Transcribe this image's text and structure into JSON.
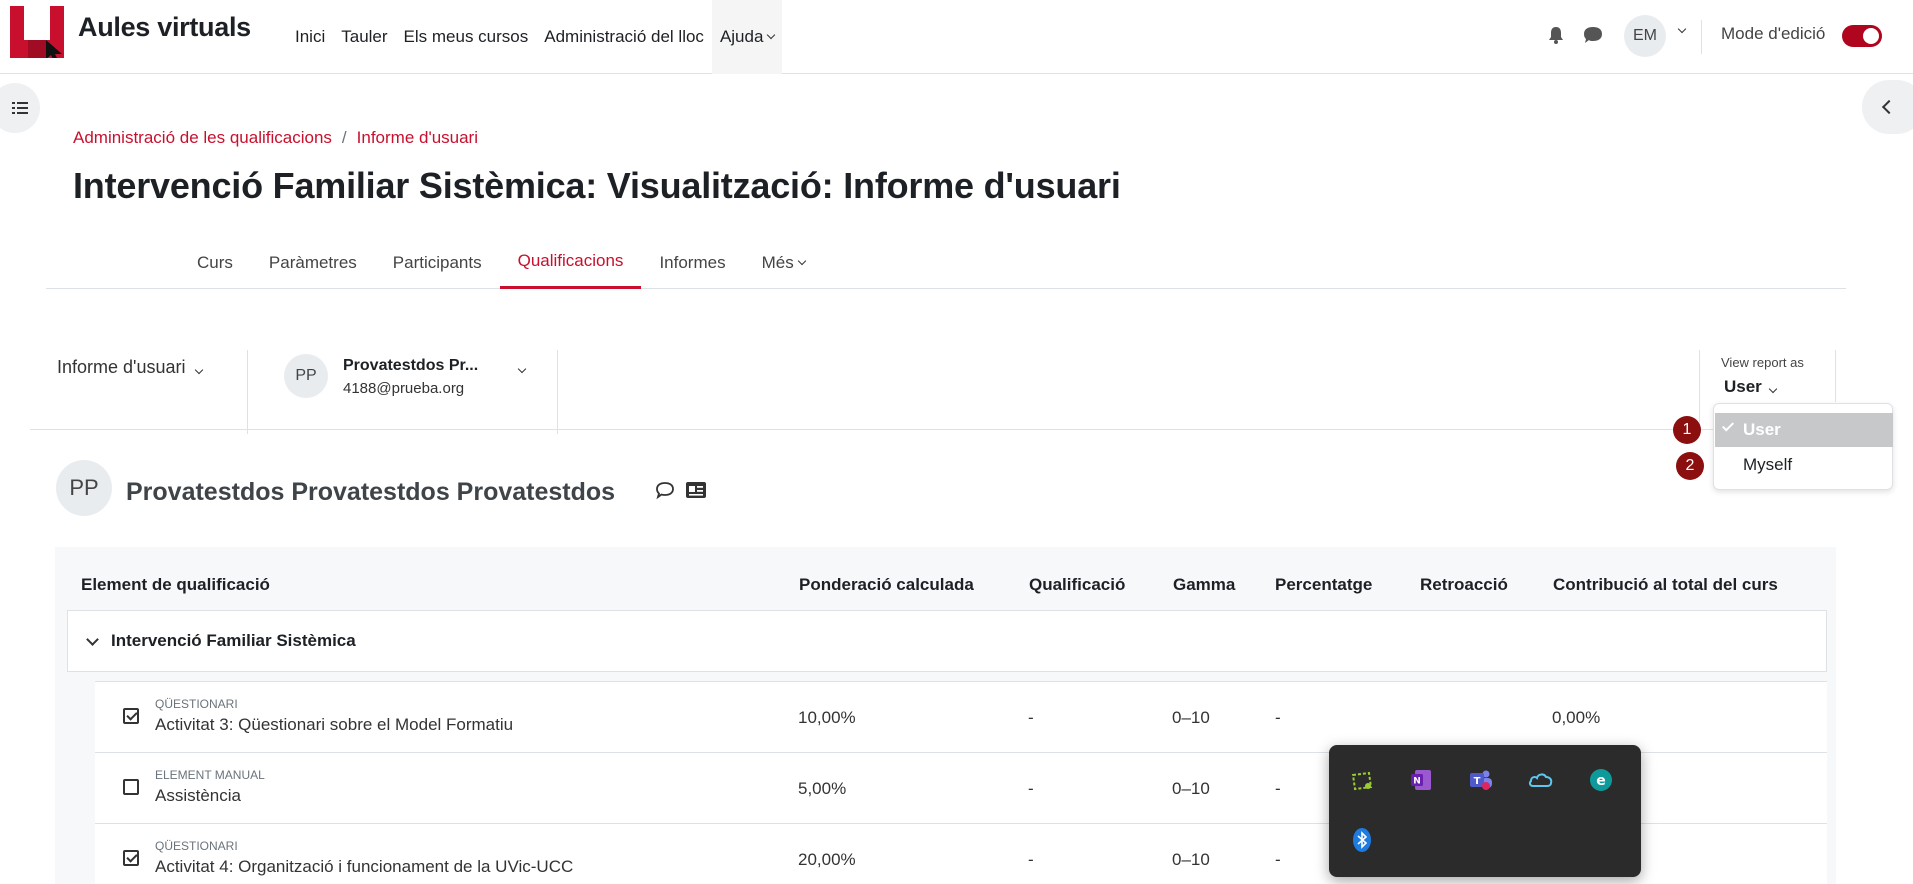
{
  "navbar": {
    "site_name": "Aules virtuals",
    "nav_items": [
      "Inici",
      "Tauler",
      "Els meus cursos",
      "Administració del lloc",
      "Ajuda"
    ],
    "user_initials": "EM",
    "edit_mode_label": "Mode d'edició",
    "edit_mode_on": true
  },
  "breadcrumb": {
    "items": [
      "Administració de les qualificacions",
      "Informe d'usuari"
    ],
    "separator": "/"
  },
  "page_title": "Intervenció Familiar Sistèmica: Visualització: Informe d'usuari",
  "secondary_nav": {
    "tabs": [
      "Curs",
      "Paràmetres",
      "Participants",
      "Qualificacions",
      "Informes",
      "Més"
    ],
    "active": "Qualificacions"
  },
  "tertiary": {
    "report_select": "Informe d'usuari",
    "user_initials": "PP",
    "user_name": "Provatestdos Pr...",
    "user_email": "4188@prueba.org",
    "view_as_label": "View report as",
    "view_as_value": "User"
  },
  "view_as_dropdown": {
    "options": [
      "User",
      "Myself"
    ],
    "selected": "User",
    "markers": [
      "1",
      "2"
    ]
  },
  "user_heading": {
    "initials": "PP",
    "full_name": "Provatestdos Provatestdos Provatestdos"
  },
  "grades_table": {
    "headers": [
      "Element de qualificació",
      "Ponderació calculada",
      "Qualificació",
      "Gamma",
      "Percentatge",
      "Retroacció",
      "Contribució al total del curs"
    ],
    "category": "Intervenció Familiar Sistèmica",
    "rows": [
      {
        "type": "Qüestionari",
        "name": "Activitat 3: Qüestionari sobre el Model Formatiu",
        "weight": "10,00%",
        "grade": "-",
        "range": "0–10",
        "percentage": "-",
        "feedback": "",
        "contribution": "0,00%",
        "icon": "quiz-icon"
      },
      {
        "type": "Element manual",
        "name": "Assistència",
        "weight": "5,00%",
        "grade": "-",
        "range": "0–10",
        "percentage": "-",
        "feedback": "",
        "contribution": "",
        "icon": "manual-item-icon"
      },
      {
        "type": "Qüestionari",
        "name": "Activitat 4: Organització i funcionament de la UVic-UCC",
        "weight": "20,00%",
        "grade": "-",
        "range": "0–10",
        "percentage": "-",
        "feedback": "",
        "contribution": "",
        "icon": "quiz-icon"
      }
    ]
  },
  "tray_icons": [
    "snipping-tool-icon",
    "onenote-icon",
    "teams-icon",
    "onedrive-icon",
    "eset-icon",
    "bluetooth-icon"
  ],
  "colors": {
    "accent": "#c8102e",
    "marker": "#8b0f0f",
    "toggle": "#b0051e"
  }
}
